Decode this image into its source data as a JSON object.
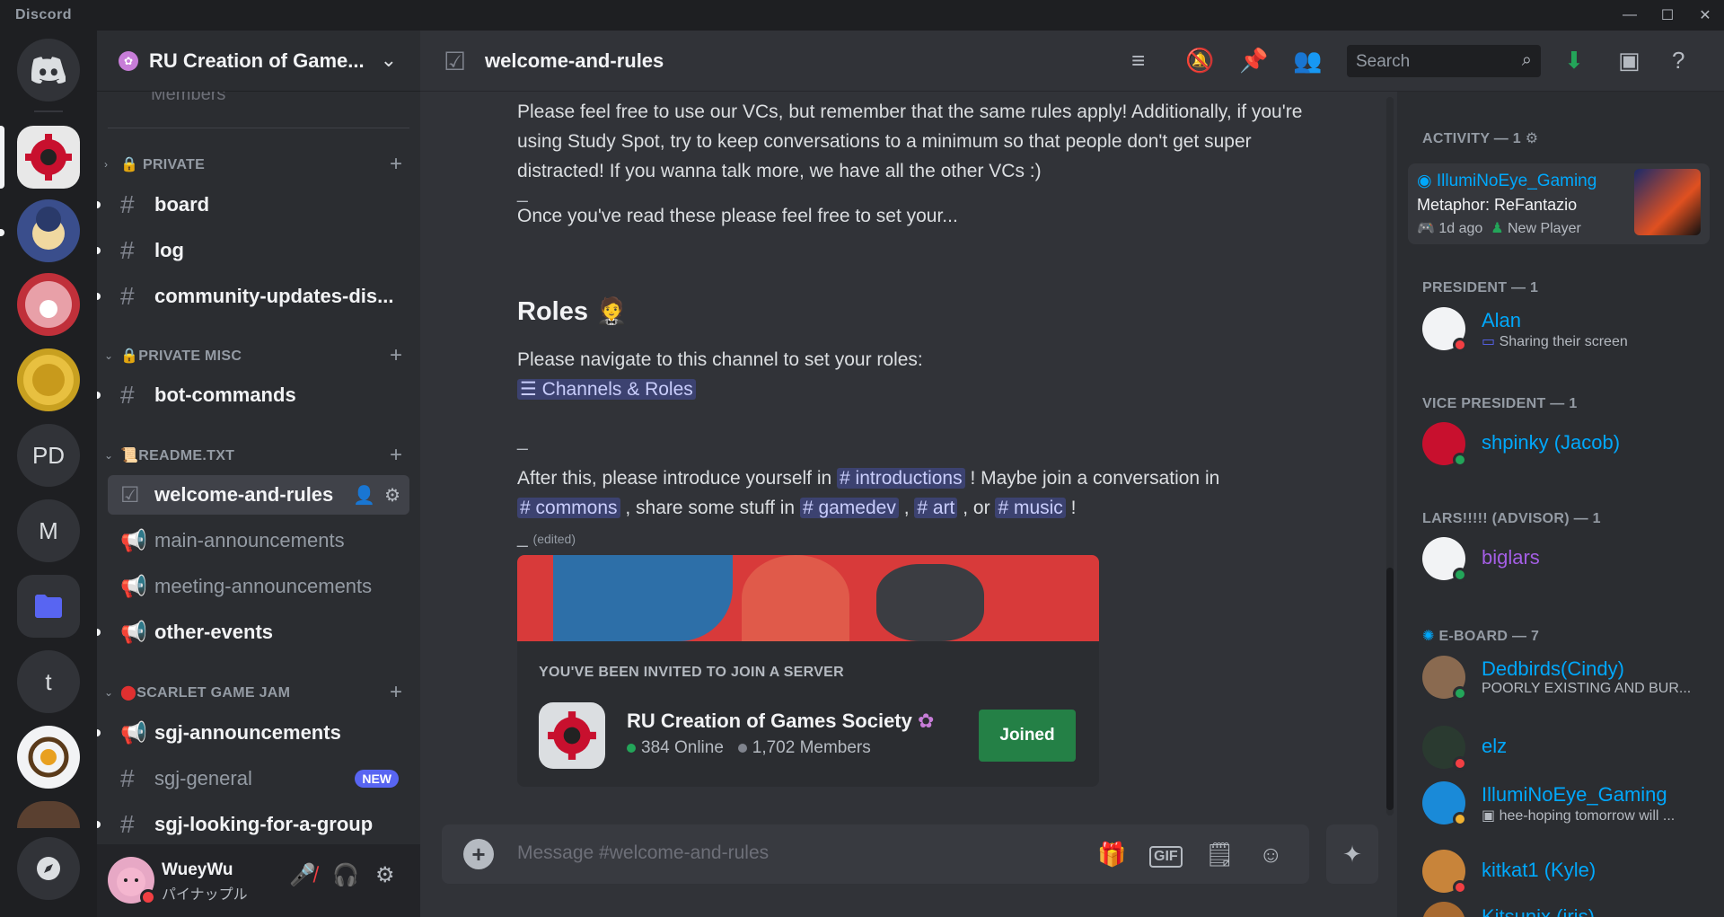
{
  "app": {
    "title": "Discord"
  },
  "rail": {
    "servers": [
      {
        "label": "PD"
      },
      {
        "label": "M"
      },
      {
        "label": "t"
      }
    ]
  },
  "sidebar": {
    "guild_name": "RU Creation of Game...",
    "partial_top": "Members",
    "categories": [
      {
        "label": "PRIVATE"
      },
      {
        "label": "PRIVATE MISC"
      },
      {
        "label": "README.TXT"
      },
      {
        "label": "SCARLET GAME JAM"
      }
    ],
    "channels": [
      {
        "label": "board"
      },
      {
        "label": "log"
      },
      {
        "label": "community-updates-dis..."
      },
      {
        "label": "bot-commands"
      },
      {
        "label": "welcome-and-rules"
      },
      {
        "label": "main-announcements"
      },
      {
        "label": "meeting-announcements"
      },
      {
        "label": "other-events"
      },
      {
        "label": "sgj-announcements"
      },
      {
        "label": "sgj-general",
        "badge": "NEW"
      },
      {
        "label": "sgj-looking-for-a-group"
      }
    ]
  },
  "user": {
    "name": "WueyWu",
    "status": "パイナップル"
  },
  "header": {
    "channel": "welcome-and-rules",
    "search_placeholder": "Search"
  },
  "messages": {
    "p1": "Please feel free to use our VCs, but remember that the same rules apply! Additionally, if you're using Study Spot, try to keep conversations to a minimum so that people don't get super distracted! If you wanna talk more, we have all the other VCs :)",
    "dash1": "_",
    "p2": "Once you've read these please feel free to set your...",
    "roles_heading": "Roles",
    "roles_emoji": "🤵",
    "p3": "Please navigate to this channel to set your roles:",
    "channels_roles": "Channels & Roles",
    "dash2": "_",
    "p4a": "After this, please introduce yourself in",
    "m_intro": "# introductions",
    "p4b": "! Maybe join a conversation in",
    "m_commons": "# commons",
    "p4c": ", share some stuff in",
    "m_gamedev": "# gamedev",
    "comma": ",",
    "m_art": "# art",
    "p4d": ", or",
    "m_music": "# music",
    "p4e": "!",
    "dash3": "_",
    "edited": "(edited)"
  },
  "invite": {
    "title": "YOU'VE BEEN INVITED TO JOIN A SERVER",
    "server": "RU Creation of Games Society",
    "online": "384 Online",
    "members": "1,702 Members",
    "button": "Joined"
  },
  "composer": {
    "placeholder": "Message #welcome-and-rules"
  },
  "member_list": {
    "groups": [
      {
        "label": "ACTIVITY — 1"
      },
      {
        "label": "PRESIDENT — 1"
      },
      {
        "label": "VICE PRESIDENT — 1"
      },
      {
        "label": "LARS!!!!! (ADVISOR) — 1"
      },
      {
        "label": "E-BOARD — 7"
      }
    ],
    "activity": {
      "user": "IllumiNoEye_Gaming",
      "game": "Metaphor: ReFantazio",
      "time": "1d ago",
      "tag": "New Player"
    },
    "members": [
      {
        "name": "Alan",
        "sub": "Sharing their screen",
        "color": "#00a8fc"
      },
      {
        "name": "shpinky (Jacob)",
        "sub": "",
        "color": "#00a8fc"
      },
      {
        "name": "biglars",
        "sub": "",
        "color": "#a45ee5"
      },
      {
        "name": "Dedbirds(Cindy)",
        "sub": "POORLY EXISTING AND BUR...",
        "color": "#00a8fc"
      },
      {
        "name": "elz",
        "sub": "",
        "color": "#00a8fc"
      },
      {
        "name": "IllumiNoEye_Gaming",
        "sub": "hee-hoping tomorrow will ...",
        "color": "#00a8fc"
      },
      {
        "name": "kitkat1 (Kyle)",
        "sub": "",
        "color": "#00a8fc"
      },
      {
        "name": "Kitsunix (iris)",
        "sub": "",
        "color": "#00a8fc"
      }
    ]
  }
}
